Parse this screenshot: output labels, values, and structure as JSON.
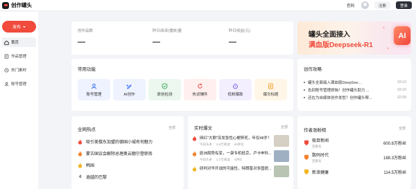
{
  "app": {
    "logo_text": "创作罐头"
  },
  "topbar": {
    "links": [
      "官网"
    ],
    "register": "注册",
    "login": "登录"
  },
  "sidebar": {
    "publish_label": "发布",
    "items": [
      {
        "label": "首页",
        "icon": "home-icon",
        "active": true
      },
      {
        "label": "作品管理",
        "icon": "works-icon",
        "active": false
      },
      {
        "label": "热门素材",
        "icon": "clock-icon",
        "active": false
      },
      {
        "label": "账号管理",
        "icon": "account-icon",
        "active": false
      }
    ]
  },
  "stats": [
    {
      "label": "创作品数",
      "value": "—"
    },
    {
      "label": "昨日阅读(播放)量",
      "value": "—"
    },
    {
      "label": "昨日收益(元)",
      "value": "—"
    }
  ],
  "banner": {
    "title": "罐头全面接入",
    "subtitle": "满血版Deepseek-R1",
    "badge": "AI"
  },
  "tools": {
    "title": "常用功能",
    "items": [
      {
        "label": "账号管理",
        "icon": "user-icon",
        "bg": "#eef3ff",
        "color": "#3a6ff0"
      },
      {
        "label": "AI创作",
        "icon": "ai-pen-icon",
        "bg": "#eef3ff",
        "color": "#3a6ff0"
      },
      {
        "label": "原创检测",
        "icon": "shield-check-icon",
        "bg": "#ecf8ef",
        "color": "#36a85a"
      },
      {
        "label": "热词辅件",
        "icon": "refresh-icon",
        "bg": "#fff0ef",
        "color": "#f0463c"
      },
      {
        "label": "低粉爆款",
        "icon": "explosion-icon",
        "bg": "#f3efff",
        "color": "#7b5bea"
      },
      {
        "label": "爆文标题",
        "icon": "document-icon",
        "bg": "#fff6e8",
        "color": "#f09a1c"
      }
    ]
  },
  "strategy": {
    "title": "创作攻略",
    "items": [
      {
        "text": "罐头全面接入满血版DeepSee...",
        "date": "03-10"
      },
      {
        "text": "告别账号管理烦恼！创作罐头助力 ...",
        "date": "03-10"
      },
      {
        "text": "还在为自媒体创作发愁？创作罐头帮...",
        "date": "02-08"
      }
    ]
  },
  "hot": {
    "title": "全网热点",
    "more": "全部",
    "items": [
      {
        "rank": 1,
        "text": "吸引美俄东加盟的德国小城有何魅力"
      },
      {
        "rank": 2,
        "text": "蒙古国议会解除总理奥云额尔登职务"
      },
      {
        "rank": 3,
        "text": "韩国"
      },
      {
        "rank": 4,
        "text": "逾越的巴黎"
      }
    ]
  },
  "news": {
    "title": "实时爆文",
    "more": "全部",
    "items": [
      {
        "title": "网红\"大刚\"突发急性心梗猝死，年仅48岁！",
        "source": "今日头条",
        "views": "2.6万阅读",
        "comments": "40评论",
        "thumb": "#d6cfc4"
      },
      {
        "title": "欧洲局势有变，一架专机抵京，卢卡申科...",
        "source": "今日头条",
        "views": "1.7万阅读",
        "comments": "4评论",
        "thumb": "#9fb0c2"
      },
      {
        "title": "研判对华开战的可能性，特朗普对多国提...",
        "source": "",
        "views": "",
        "comments": "",
        "thumb": "#b9c4b2"
      }
    ]
  },
  "rank": {
    "title": "作者涨粉榜",
    "more": "全部",
    "items": [
      {
        "name": "极目新闻",
        "tag": "百家号",
        "fans": "600.8万粉丝",
        "badge_color": "#f04b3c"
      },
      {
        "name": "数码时代",
        "tag": "百家号",
        "fans": "188.3万粉丝",
        "badge_color": "#f3812b"
      },
      {
        "name": "新浪健康",
        "tag": "",
        "fans": "114.5万粉丝",
        "badge_color": "#f2b51f"
      }
    ]
  },
  "colors": {
    "accent": "#f04b3c",
    "background": "#f3f4f7"
  }
}
